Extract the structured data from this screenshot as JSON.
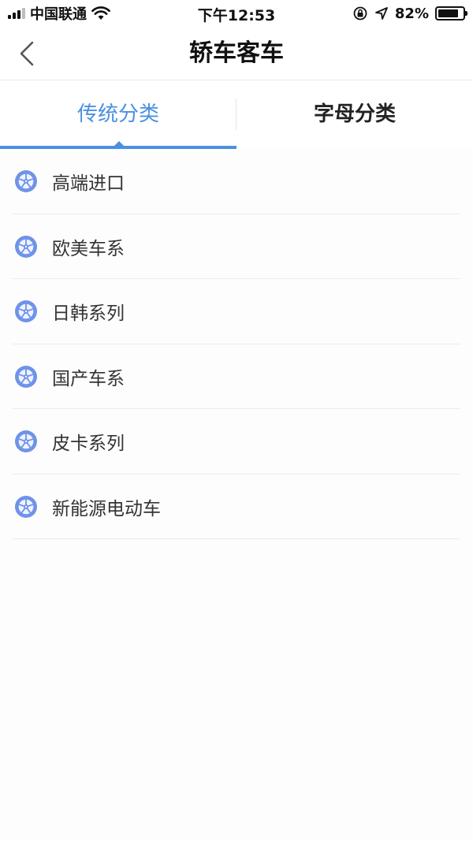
{
  "status_bar": {
    "carrier": "中国联通",
    "time": "下午12:53",
    "battery_percent": "82%",
    "battery_level": 0.82
  },
  "nav": {
    "title": "轿车客车",
    "back_icon": "chevron-left-icon"
  },
  "tabs": [
    {
      "label": "传统分类",
      "active": true
    },
    {
      "label": "字母分类",
      "active": false
    }
  ],
  "categories": [
    {
      "label": "高端进口",
      "icon": "wheel-icon"
    },
    {
      "label": "欧美车系",
      "icon": "wheel-icon"
    },
    {
      "label": "日韩系列",
      "icon": "wheel-icon"
    },
    {
      "label": "国产车系",
      "icon": "wheel-icon"
    },
    {
      "label": "皮卡系列",
      "icon": "wheel-icon"
    },
    {
      "label": "新能源电动车",
      "icon": "wheel-icon"
    }
  ],
  "colors": {
    "accent": "#4a90e2",
    "background": "#fdfdfd",
    "divider": "#ececec"
  }
}
